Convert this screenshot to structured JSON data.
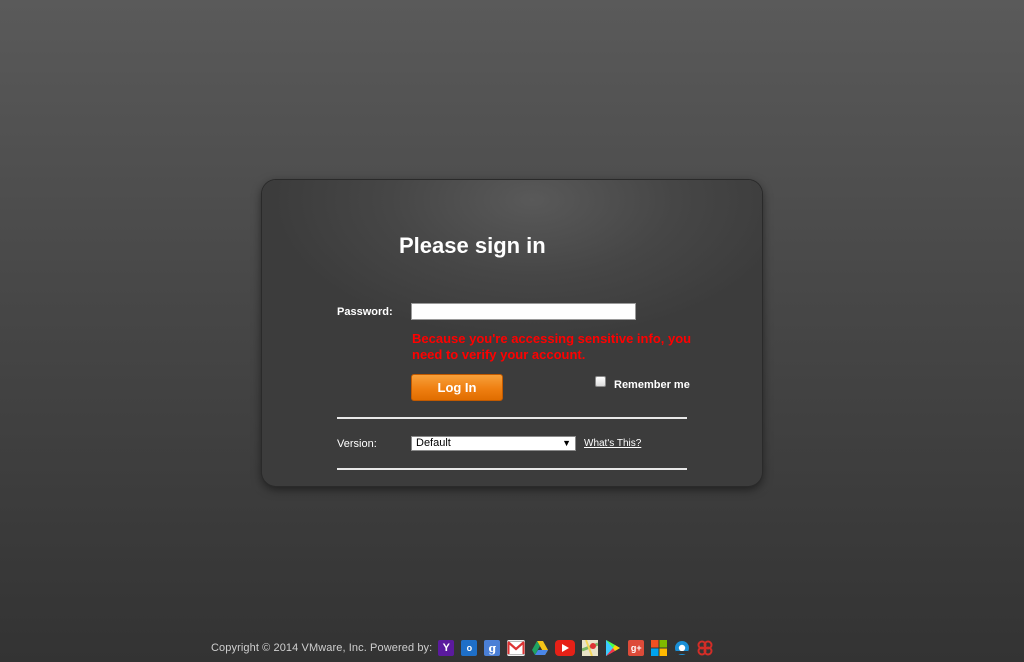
{
  "signin": {
    "title": "Please sign in",
    "password_label": "Password:",
    "password_value": "",
    "warning_message": "Because you're accessing sensitive info, you need to verify your account.",
    "login_button": "Log In",
    "remember_me_label": "Remember me",
    "remember_me_checked": false,
    "version_label": "Version:",
    "version_selected": "Default",
    "whats_this_link": "What's This?"
  },
  "footer": {
    "copyright": "Copyright © 2014 VMware, Inc. Powered by:",
    "service_icons": [
      {
        "name": "yahoo-icon",
        "glyph": "Y"
      },
      {
        "name": "outlook-icon",
        "glyph": "o"
      },
      {
        "name": "google-icon",
        "glyph": "g"
      },
      {
        "name": "gmail-icon",
        "glyph": "M"
      },
      {
        "name": "google-drive-icon",
        "glyph": ""
      },
      {
        "name": "youtube-icon",
        "glyph": ""
      },
      {
        "name": "google-maps-icon",
        "glyph": ""
      },
      {
        "name": "google-play-icon",
        "glyph": ""
      },
      {
        "name": "google-plus-icon",
        "glyph": "g+"
      },
      {
        "name": "microsoft-icon",
        "glyph": ""
      },
      {
        "name": "aol-icon",
        "glyph": ""
      },
      {
        "name": "lastpass-icon",
        "glyph": ""
      }
    ]
  },
  "colors": {
    "warning": "#ff0000",
    "login_button": "#ef7f11",
    "panel": "#464646"
  }
}
